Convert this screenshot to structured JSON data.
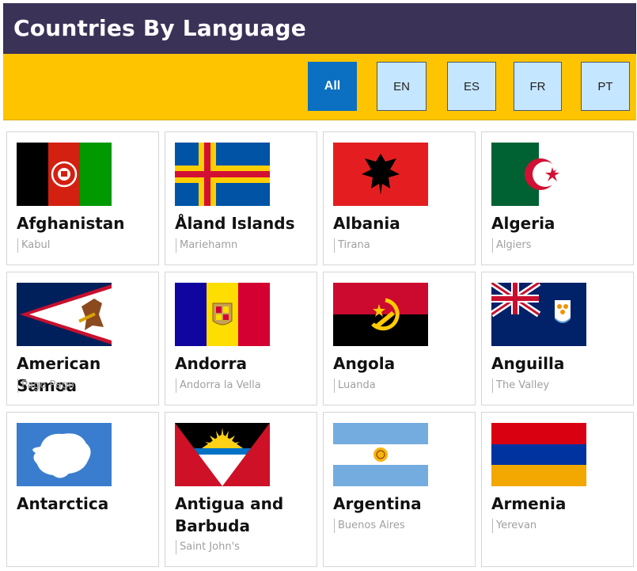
{
  "header": {
    "title": "Countries By Language"
  },
  "filters": [
    {
      "label": "All",
      "active": true
    },
    {
      "label": "EN",
      "active": false
    },
    {
      "label": "ES",
      "active": false
    },
    {
      "label": "FR",
      "active": false
    },
    {
      "label": "PT",
      "active": false
    }
  ],
  "countries": [
    {
      "name": "Afghanistan",
      "capital": "Kabul",
      "flag": "afghanistan-flag"
    },
    {
      "name": "Åland Islands",
      "capital": "Mariehamn",
      "flag": "aland-islands-flag"
    },
    {
      "name": "Albania",
      "capital": "Tirana",
      "flag": "albania-flag"
    },
    {
      "name": "Algeria",
      "capital": "Algiers",
      "flag": "algeria-flag"
    },
    {
      "name": "American Samoa",
      "capital": "Pago Pago",
      "flag": "american-samoa-flag"
    },
    {
      "name": "Andorra",
      "capital": "Andorra la Vella",
      "flag": "andorra-flag"
    },
    {
      "name": "Angola",
      "capital": "Luanda",
      "flag": "angola-flag"
    },
    {
      "name": "Anguilla",
      "capital": "The Valley",
      "flag": "anguilla-flag"
    },
    {
      "name": "Antarctica",
      "capital": "",
      "flag": "antarctica-flag"
    },
    {
      "name": "Antigua and Barbuda",
      "capital": "Saint John's",
      "flag": "antigua-and-barbuda-flag"
    },
    {
      "name": "Argentina",
      "capital": "Buenos Aires",
      "flag": "argentina-flag"
    },
    {
      "name": "Armenia",
      "capital": "Yerevan",
      "flag": "armenia-flag"
    }
  ],
  "colors": {
    "header_bg": "#3b3257",
    "filter_bar_bg": "#ffc400",
    "filter_active_bg": "#0b6fc2",
    "filter_inactive_bg": "#c5e6ff"
  }
}
